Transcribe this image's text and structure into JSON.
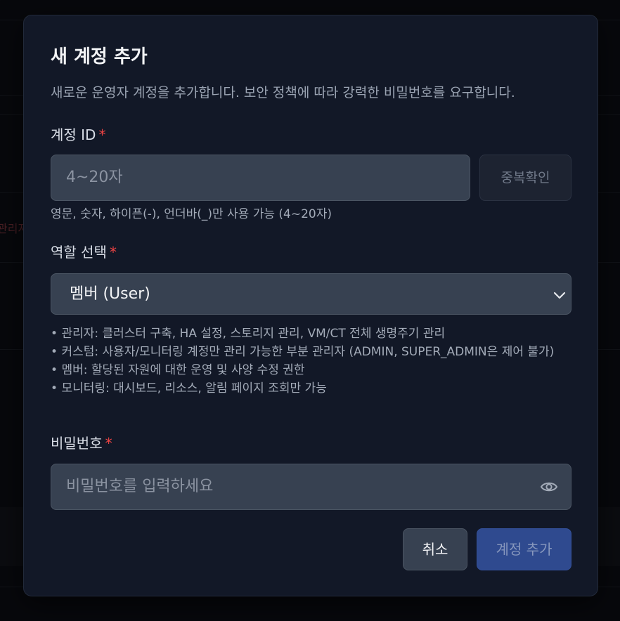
{
  "background": {
    "ghost_text": "관리자"
  },
  "dialog": {
    "title": "새 계정 추가",
    "description": "새로운 운영자 계정을 추가합니다. 보안 정책에 따라 강력한 비밀번호를 요구합니다.",
    "required_mark": "*",
    "account_id": {
      "label": "계정 ID",
      "placeholder": "4~20자",
      "value": "",
      "check_button": "중복확인",
      "help": "영문, 숫자, 하이픈(-), 언더바(_)만 사용 가능 (4~20자)"
    },
    "role": {
      "label": "역할 선택",
      "selected": "멤버 (User)",
      "descriptions": [
        "관리자: 클러스터 구축, HA 설정, 스토리지 관리, VM/CT 전체 생명주기 관리",
        "커스텀: 사용자/모니터링 계정만 관리 가능한 부분 관리자 (ADMIN, SUPER_ADMIN은 제어 불가)",
        "멤버: 할당된 자원에 대한 운영 및 사양 수정 권한",
        "모니터링: 대시보드, 리소스, 알림 페이지 조회만 가능"
      ]
    },
    "password": {
      "label": "비밀번호",
      "placeholder": "비밀번호를 입력하세요",
      "value": "",
      "toggle_icon": "eye-icon"
    },
    "buttons": {
      "cancel": "취소",
      "submit": "계정 추가"
    }
  },
  "colors": {
    "dialog_bg": "#121827",
    "input_bg": "#374151",
    "required": "#ef4444",
    "primary_button": "#2f4a8f"
  }
}
